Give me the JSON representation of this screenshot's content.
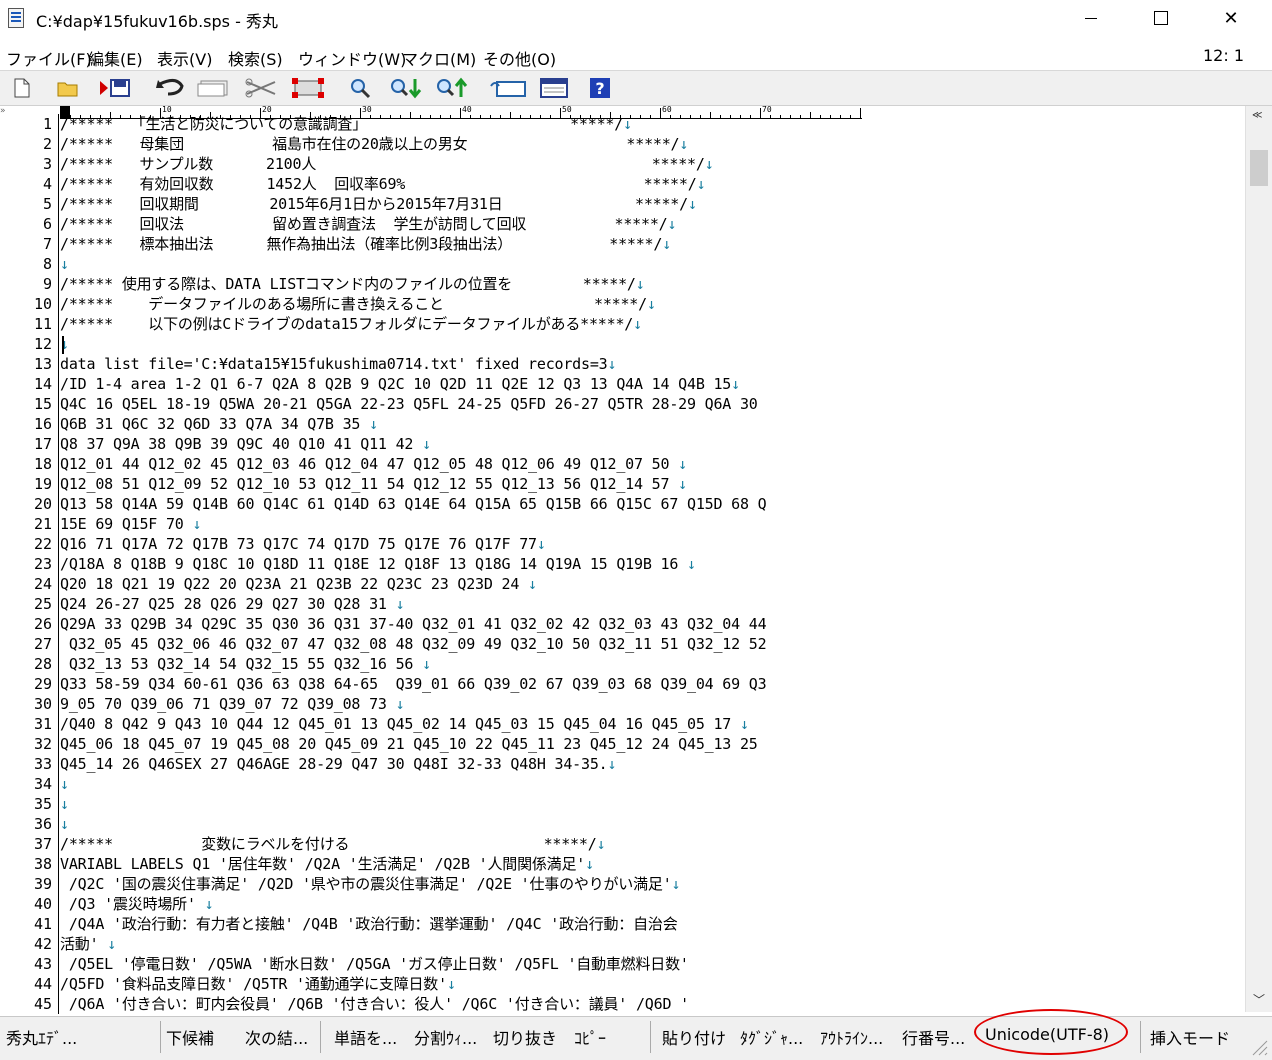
{
  "window": {
    "title": "C:¥dap¥15fukuv16b.sps - 秀丸",
    "minimize": "",
    "maximize": "",
    "close": "✕"
  },
  "menu": {
    "items": [
      "ファイル(F)",
      "編集(E)",
      "表示(V)",
      "検索(S)",
      "ウィンドウ(W)",
      "マクロ(M)",
      "その他(O)"
    ],
    "cursor_position": "12: 1"
  },
  "toolbar": {
    "icons": [
      "new-file-icon",
      "open-folder-icon",
      "save-icon",
      "undo-icon",
      "window-icon",
      "cut-icon",
      "select-icon",
      "find-icon",
      "find-next-icon",
      "find-prev-icon",
      "grep-icon",
      "list-icon",
      "help-icon"
    ]
  },
  "ruler": {
    "labels": [
      "0",
      "10",
      "20",
      "30",
      "40",
      "50",
      "60",
      "70"
    ]
  },
  "editor": {
    "eol": "↓",
    "lines": [
      {
        "n": "1",
        "t": "/*****  「生活と防災についての意識調査」                       *****/",
        "eol": true
      },
      {
        "n": "2",
        "t": "/*****   母集団          福島市在住の20歳以上の男女                  *****/",
        "eol": true
      },
      {
        "n": "3",
        "t": "/*****   サンプル数      2100人                                      *****/",
        "eol": true
      },
      {
        "n": "4",
        "t": "/*****   有効回収数      1452人  回収率69%                           *****/",
        "eol": true
      },
      {
        "n": "5",
        "t": "/*****   回収期間        2015年6月1日から2015年7月31日               *****/",
        "eol": true
      },
      {
        "n": "6",
        "t": "/*****   回収法          留め置き調査法  学生が訪問して回収          *****/",
        "eol": true
      },
      {
        "n": "7",
        "t": "/*****   標本抽出法      無作為抽出法（確率比例3段抽出法）           *****/",
        "eol": true
      },
      {
        "n": "8",
        "t": "",
        "eol": true
      },
      {
        "n": "9",
        "t": "/***** 使用する際は、DATA LISTコマンド内のファイルの位置を        *****/",
        "eol": true
      },
      {
        "n": "10",
        "t": "/*****    データファイルのある場所に書き換えること                 *****/",
        "eol": true
      },
      {
        "n": "11",
        "t": "/*****    以下の例はCドライブのdata15フォルダにデータファイルがある*****/",
        "eol": true
      },
      {
        "n": "12",
        "t": "",
        "eol": true
      },
      {
        "n": "13",
        "t": "data list file='C:¥data15¥15fukushima0714.txt' fixed records=3",
        "eol": true
      },
      {
        "n": "14",
        "t": "/ID 1-4 area 1-2 Q1 6-7 Q2A 8 Q2B 9 Q2C 10 Q2D 11 Q2E 12 Q3 13 Q4A 14 Q4B 15",
        "eol": true
      },
      {
        "n": "15",
        "t": "Q4C 16 Q5EL 18-19 Q5WA 20-21 Q5GA 22-23 Q5FL 24-25 Q5FD 26-27 Q5TR 28-29 Q6A 30",
        "eol": false
      },
      {
        "n": "16",
        "t": "Q6B 31 Q6C 32 Q6D 33 Q7A 34 Q7B 35 ",
        "eol": true
      },
      {
        "n": "17",
        "t": "Q8 37 Q9A 38 Q9B 39 Q9C 40 Q10 41 Q11 42 ",
        "eol": true
      },
      {
        "n": "18",
        "t": "Q12_01 44 Q12_02 45 Q12_03 46 Q12_04 47 Q12_05 48 Q12_06 49 Q12_07 50 ",
        "eol": true
      },
      {
        "n": "19",
        "t": "Q12_08 51 Q12_09 52 Q12_10 53 Q12_11 54 Q12_12 55 Q12_13 56 Q12_14 57 ",
        "eol": true
      },
      {
        "n": "20",
        "t": "Q13 58 Q14A 59 Q14B 60 Q14C 61 Q14D 63 Q14E 64 Q15A 65 Q15B 66 Q15C 67 Q15D 68 Q",
        "eol": false
      },
      {
        "n": "21",
        "t": "15E 69 Q15F 70 ",
        "eol": true
      },
      {
        "n": "22",
        "t": "Q16 71 Q17A 72 Q17B 73 Q17C 74 Q17D 75 Q17E 76 Q17F 77",
        "eol": true
      },
      {
        "n": "23",
        "t": "/Q18A 8 Q18B 9 Q18C 10 Q18D 11 Q18E 12 Q18F 13 Q18G 14 Q19A 15 Q19B 16 ",
        "eol": true
      },
      {
        "n": "24",
        "t": "Q20 18 Q21 19 Q22 20 Q23A 21 Q23B 22 Q23C 23 Q23D 24 ",
        "eol": true
      },
      {
        "n": "25",
        "t": "Q24 26-27 Q25 28 Q26 29 Q27 30 Q28 31 ",
        "eol": true
      },
      {
        "n": "26",
        "t": "Q29A 33 Q29B 34 Q29C 35 Q30 36 Q31 37-40 Q32_01 41 Q32_02 42 Q32_03 43 Q32_04 44",
        "eol": false
      },
      {
        "n": "27",
        "t": " Q32_05 45 Q32_06 46 Q32_07 47 Q32_08 48 Q32_09 49 Q32_10 50 Q32_11 51 Q32_12 52",
        "eol": false
      },
      {
        "n": "28",
        "t": " Q32_13 53 Q32_14 54 Q32_15 55 Q32_16 56 ",
        "eol": true
      },
      {
        "n": "29",
        "t": "Q33 58-59 Q34 60-61 Q36 63 Q38 64-65  Q39_01 66 Q39_02 67 Q39_03 68 Q39_04 69 Q3",
        "eol": false
      },
      {
        "n": "30",
        "t": "9_05 70 Q39_06 71 Q39_07 72 Q39_08 73 ",
        "eol": true
      },
      {
        "n": "31",
        "t": "/Q40 8 Q42 9 Q43 10 Q44 12 Q45_01 13 Q45_02 14 Q45_03 15 Q45_04 16 Q45_05 17 ",
        "eol": true
      },
      {
        "n": "32",
        "t": "Q45_06 18 Q45_07 19 Q45_08 20 Q45_09 21 Q45_10 22 Q45_11 23 Q45_12 24 Q45_13 25",
        "eol": false
      },
      {
        "n": "33",
        "t": "Q45_14 26 Q46SEX 27 Q46AGE 28-29 Q47 30 Q48I 32-33 Q48H 34-35.",
        "eol": true
      },
      {
        "n": "34",
        "t": "",
        "eol": true
      },
      {
        "n": "35",
        "t": "",
        "eol": true
      },
      {
        "n": "36",
        "t": "",
        "eol": true
      },
      {
        "n": "37",
        "t": "/*****          変数にラベルを付ける                      *****/",
        "eol": true
      },
      {
        "n": "38",
        "t": "VARIABL LABELS Q1 '居住年数' /Q2A '生活満足' /Q2B '人間関係満足'",
        "eol": true
      },
      {
        "n": "39",
        "t": " /Q2C '国の震災住事満足' /Q2D '県や市の震災住事満足' /Q2E '仕事のやりがい満足'",
        "eol": true
      },
      {
        "n": "40",
        "t": " /Q3 '震災時場所' ",
        "eol": true
      },
      {
        "n": "41",
        "t": " /Q4A '政治行動：有力者と接触' /Q4B '政治行動：選挙運動' /Q4C '政治行動：自治会",
        "eol": false
      },
      {
        "n": "42",
        "t": "活動' ",
        "eol": true
      },
      {
        "n": "43",
        "t": " /Q5EL '停電日数' /Q5WA '断水日数' /Q5GA 'ガス停止日数' /Q5FL '自動車燃料日数'",
        "eol": false
      },
      {
        "n": "44",
        "t": "/Q5FD '食料品支障日数' /Q5TR '通勤通学に支障日数'",
        "eol": true
      },
      {
        "n": "45",
        "t": " /Q6A '付き合い：町内会役員' /Q6B '付き合い：役人' /Q6C '付き合い：議員' /Q6D '",
        "eol": false
      }
    ]
  },
  "statusbar": {
    "items": [
      "秀丸ｴﾃﾞ...",
      "下候補",
      "次の結...",
      "単語を...",
      "分割ｳｨ...",
      "切り抜き",
      "ｺﾋﾟｰ",
      "貼り付け",
      "ﾀｸﾞｼﾞｬ...",
      "ｱｳﾄﾗｲﾝ...",
      "行番号...",
      "Unicode(UTF-8)",
      "挿入モード"
    ],
    "highlight_color": "#e00000"
  }
}
